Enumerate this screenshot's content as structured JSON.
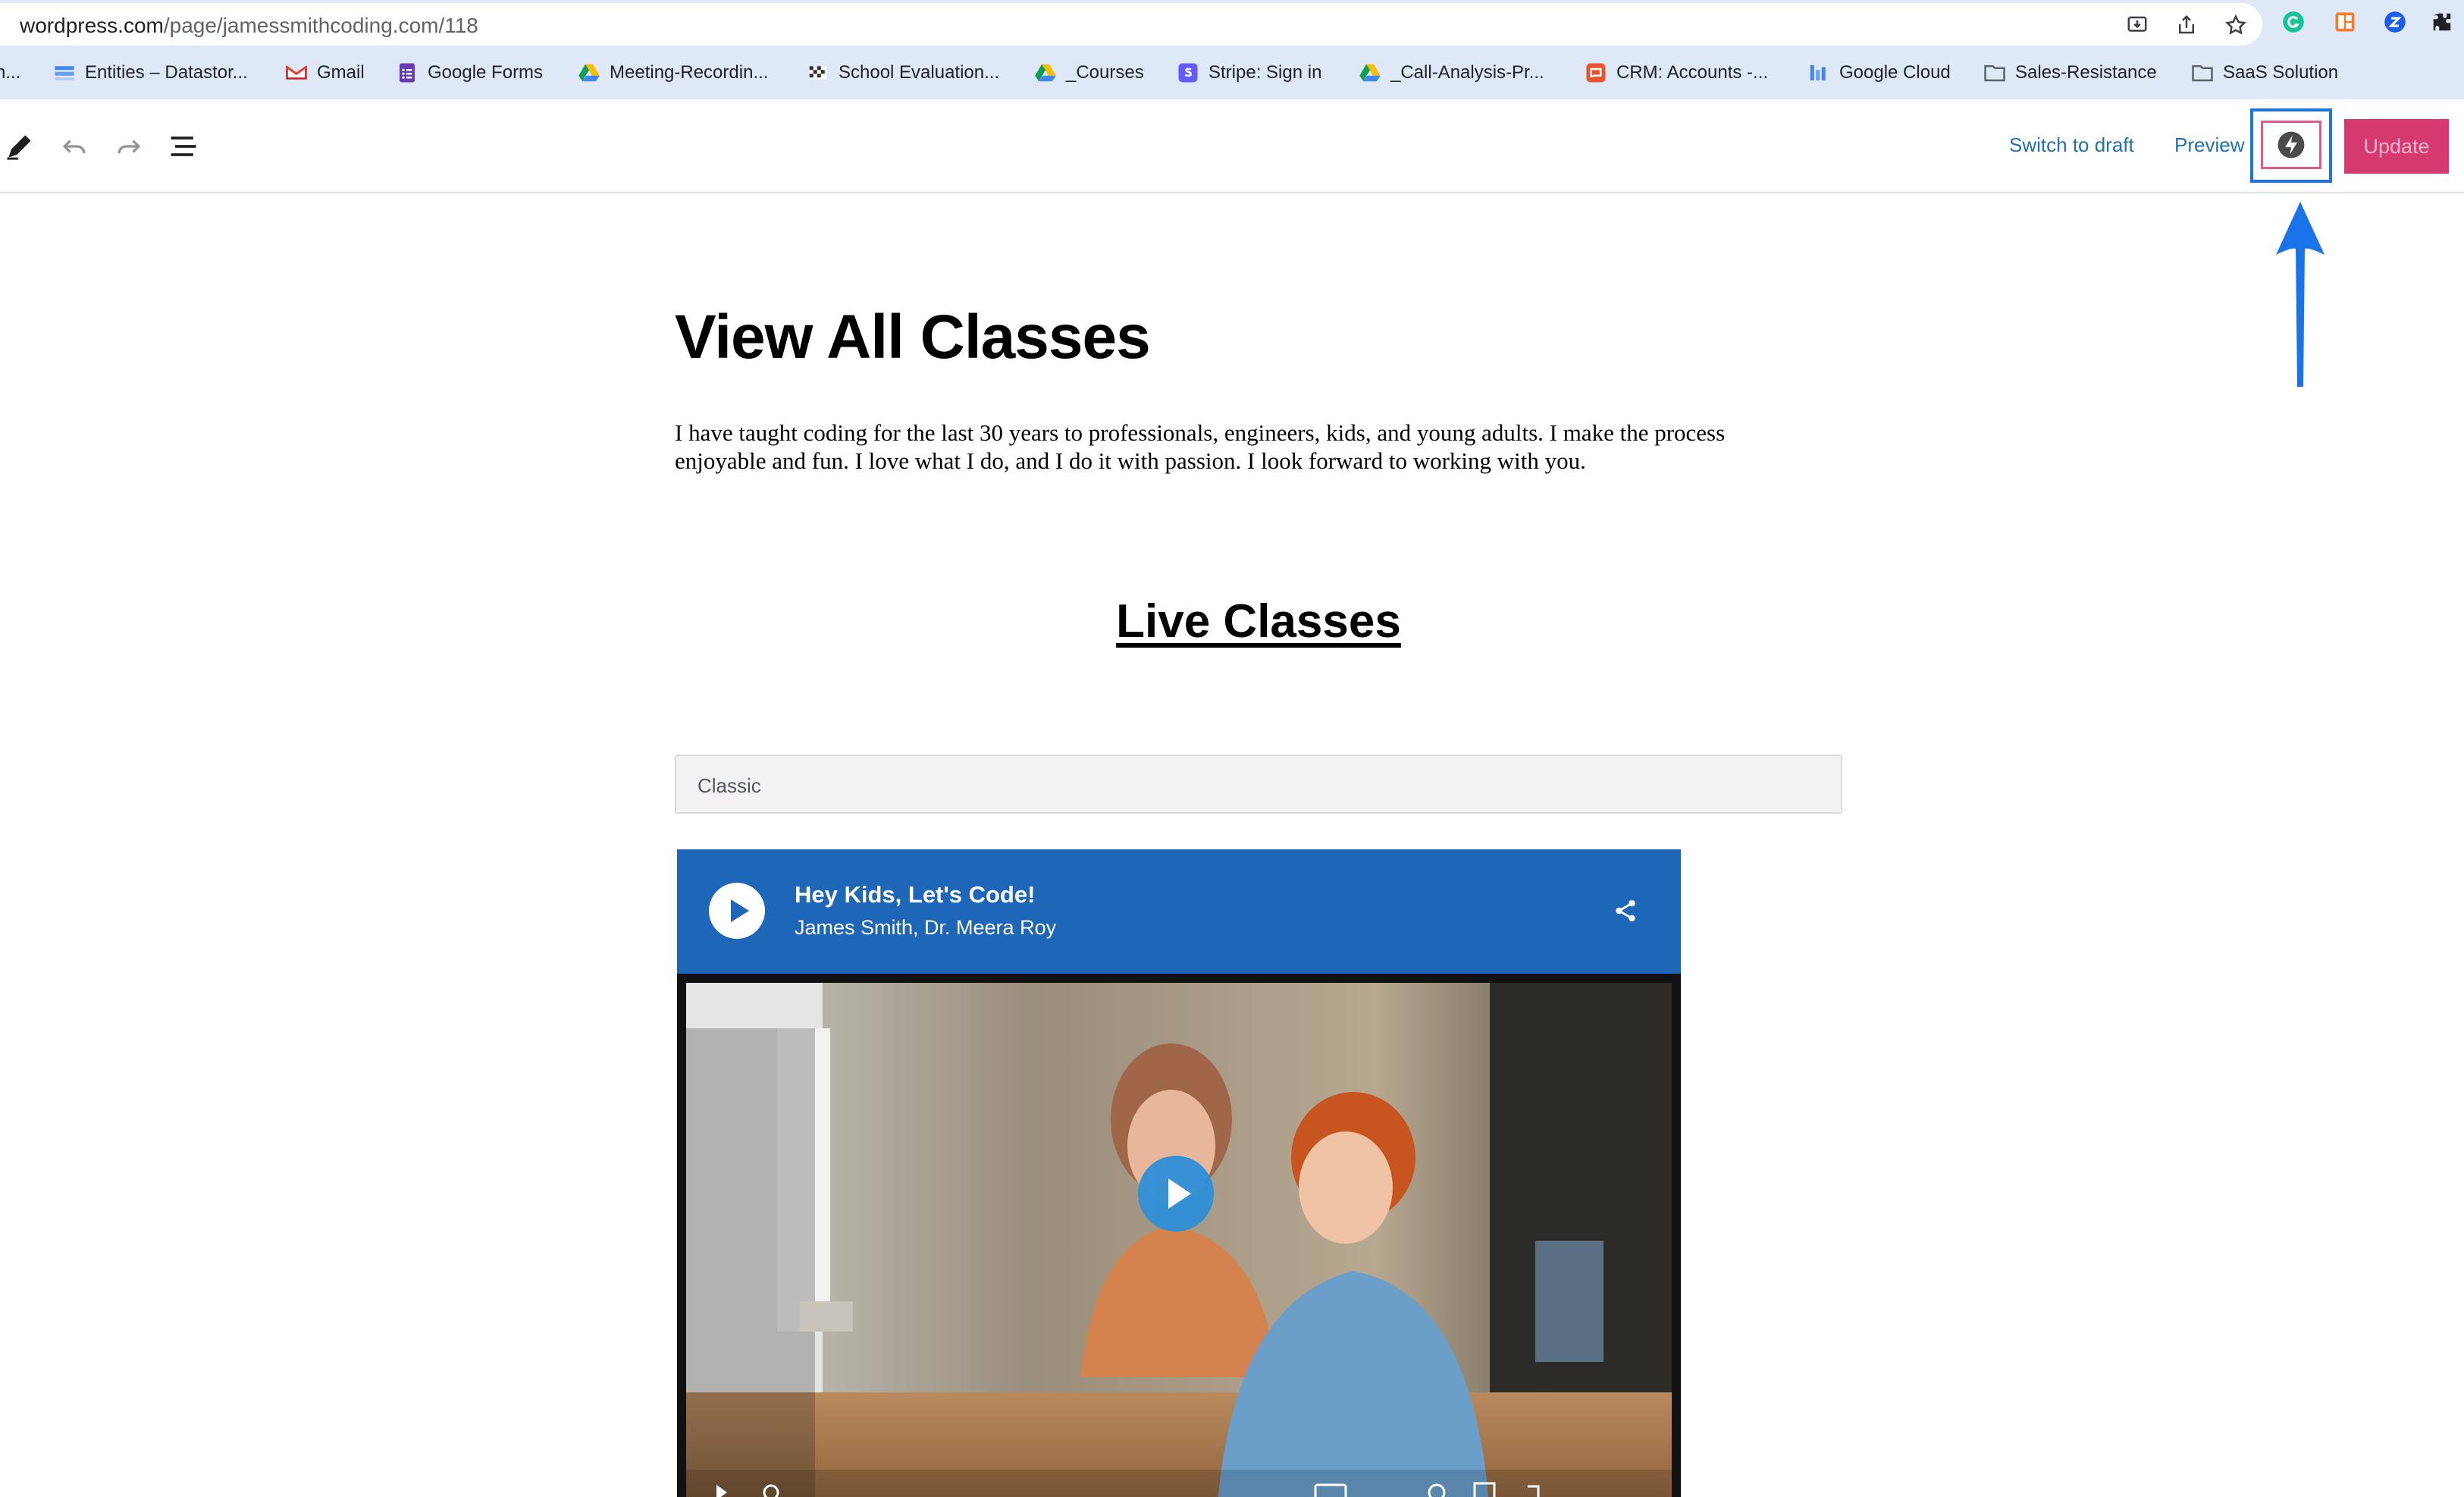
{
  "browser": {
    "url_domain": "wordpress.com",
    "url_path": "/page/jamessmithcoding.com/118",
    "bookmarks": [
      {
        "label": "n...",
        "icon": "blank-icon"
      },
      {
        "label": "Entities – Datastor...",
        "icon": "datastore-icon"
      },
      {
        "label": "Gmail",
        "icon": "gmail-icon"
      },
      {
        "label": "Google Forms",
        "icon": "google-forms-icon"
      },
      {
        "label": "Meeting-Recordin...",
        "icon": "google-drive-icon"
      },
      {
        "label": "School Evaluation...",
        "icon": "checkered-flag-icon"
      },
      {
        "label": "_Courses",
        "icon": "google-drive-icon"
      },
      {
        "label": "Stripe: Sign in",
        "icon": "stripe-icon"
      },
      {
        "label": "_Call-Analysis-Pr...",
        "icon": "google-drive-icon"
      },
      {
        "label": "CRM: Accounts -...",
        "icon": "crm-icon"
      },
      {
        "label": "Google Cloud",
        "icon": "google-cloud-icon"
      },
      {
        "label": "Sales-Resistance",
        "icon": "folder-icon"
      },
      {
        "label": "SaaS Solution",
        "icon": "folder-icon"
      }
    ]
  },
  "toolbar": {
    "switch_to_draft": "Switch to draft",
    "preview": "Preview",
    "update": "Update"
  },
  "content": {
    "title": "View All Classes",
    "intro": "I have taught coding for the last 30 years to professionals, engineers, kids, and young adults. I make the process enjoyable and fun. I love what I do, and I do it with passion. I look forward to working with you.",
    "section_heading": "Live Classes",
    "classic_block_label": "Classic",
    "player": {
      "title": "Hey Kids, Let's Code!",
      "authors": "James Smith, Dr. Meera Roy"
    }
  },
  "colors": {
    "accent": "#2271b1",
    "update_button": "#d63870",
    "player_header": "#1e66b8",
    "annotation_arrow": "#1a73e8"
  }
}
